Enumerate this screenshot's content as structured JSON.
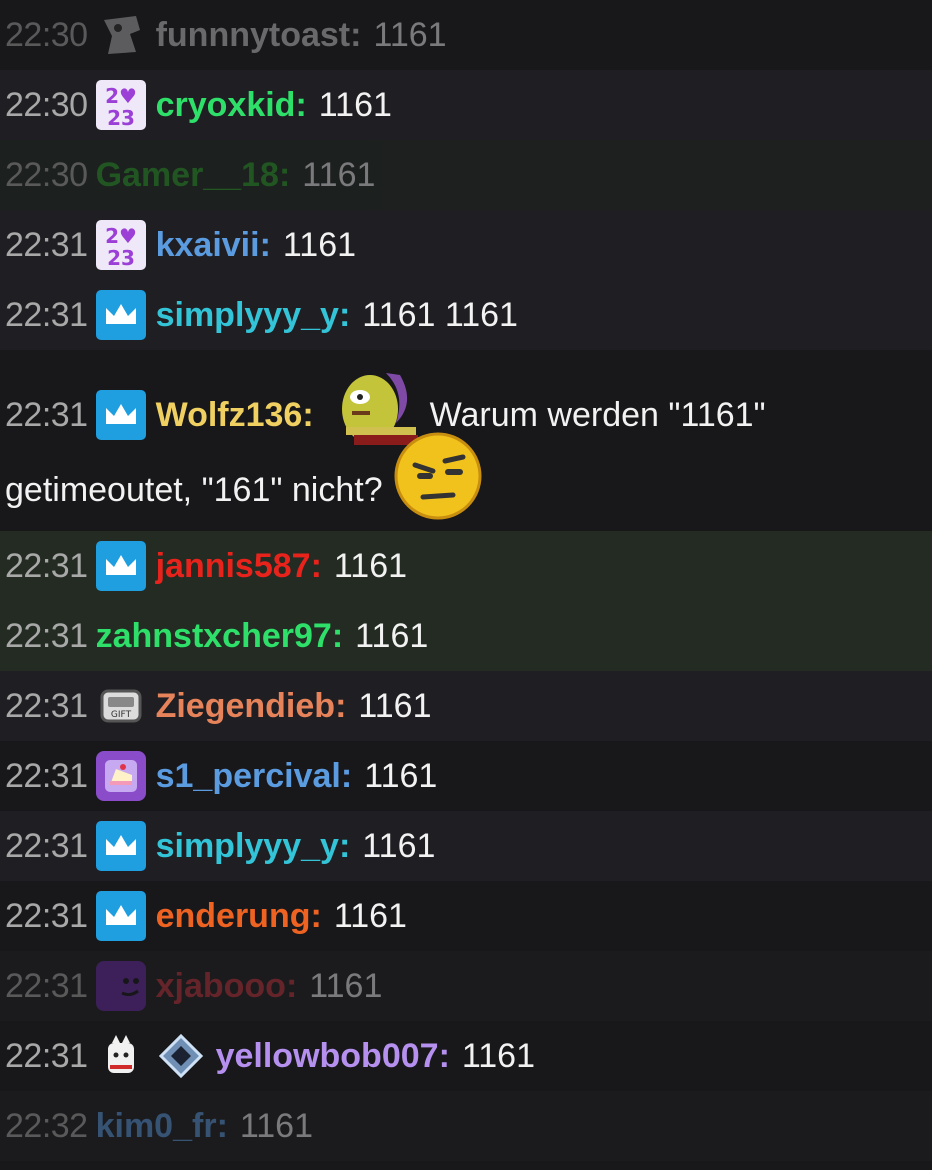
{
  "messages": [
    {
      "time": "22:30",
      "badges": [
        "avatar-icon"
      ],
      "user": "funnnytoast",
      "text": "1161",
      "color": "#cccccc",
      "faded": true
    },
    {
      "time": "22:30",
      "badges": [
        "2023-badge-icon"
      ],
      "user": "cryoxkid",
      "text": "1161",
      "color": "#2ee06a",
      "faded": false
    },
    {
      "time": "22:30",
      "badges": [],
      "user": "Gamer__18",
      "text": "1161",
      "color": "#2ea22e",
      "faded": true
    },
    {
      "time": "22:31",
      "badges": [
        "2023-badge-icon"
      ],
      "user": "kxaivii",
      "text": "1161",
      "color": "#5b9be0",
      "faded": false
    },
    {
      "time": "22:31",
      "badges": [
        "crown-icon"
      ],
      "user": "simplyyy_y",
      "text": "1161 1161",
      "color": "#33c4d8",
      "faded": false
    },
    {
      "time": "22:31",
      "badges": [
        "crown-icon"
      ],
      "user": "Wolfz136",
      "emote": "creature-emote-icon",
      "text": "Warum werden \"1161\"",
      "text_line2": "getimeoutet, \"161\" nicht?",
      "emote2": "skeptical-face-emote-icon",
      "color": "#f0d060",
      "faded": false
    },
    {
      "time": "22:31",
      "badges": [
        "crown-icon"
      ],
      "user": "jannis587",
      "text": "1161",
      "color": "#e8231c",
      "faded": false
    },
    {
      "time": "22:31",
      "badges": [],
      "user": "zahnstxcher97",
      "text": "1161",
      "color": "#2ee06a",
      "faded": false
    },
    {
      "time": "22:31",
      "badges": [
        "gear-icon"
      ],
      "user": "Ziegendieb",
      "text": "1161",
      "color": "#e6835a",
      "faded": false
    },
    {
      "time": "22:31",
      "badges": [
        "cake-icon"
      ],
      "user": "s1_percival",
      "text": "1161",
      "color": "#5b9be0",
      "faded": false
    },
    {
      "time": "22:31",
      "badges": [
        "crown-icon"
      ],
      "user": "simplyyy_y",
      "text": "1161",
      "color": "#33c4d8",
      "faded": false
    },
    {
      "time": "22:31",
      "badges": [
        "crown-icon"
      ],
      "user": "enderung",
      "text": "1161",
      "color": "#ee6322",
      "faded": false
    },
    {
      "time": "22:31",
      "badges": [
        "purple-face-icon"
      ],
      "user": "xjabooo",
      "text": "1161",
      "color": "#c0343a",
      "faded": true
    },
    {
      "time": "22:31",
      "badges": [
        "ghost-icon",
        "diamond-icon"
      ],
      "user": "yellowbob007",
      "text": "1161",
      "color": "#b690ef",
      "faded": false
    },
    {
      "time": "22:32",
      "badges": [],
      "user": "kim0_fr",
      "text": "1161",
      "color": "#5b9be0",
      "faded": true
    }
  ]
}
